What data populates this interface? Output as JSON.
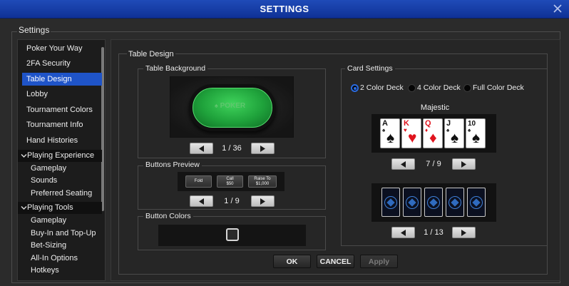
{
  "window": {
    "title": "SETTINGS"
  },
  "main_label": "Settings",
  "sidebar": {
    "items": [
      {
        "label": "Poker Your Way"
      },
      {
        "label": "2FA Security"
      },
      {
        "label": "Table Design",
        "active": true
      },
      {
        "label": "Lobby"
      },
      {
        "label": "Tournament Colors"
      },
      {
        "label": "Tournament Info"
      },
      {
        "label": "Hand Histories"
      }
    ],
    "groups": [
      {
        "label": "Playing Experience",
        "expanded": true,
        "children": [
          "Gameplay",
          "Sounds",
          "Preferred Seating"
        ]
      },
      {
        "label": "Playing Tools",
        "expanded": true,
        "children": [
          "Gameplay",
          "Buy-In and Top-Up",
          "Bet-Sizing",
          "All-In Options",
          "Hotkeys"
        ]
      }
    ]
  },
  "panel": {
    "title": "Table Design",
    "table_background": {
      "label": "Table Background",
      "counter": "1 / 36",
      "logo_text": "POKER"
    },
    "buttons_preview": {
      "label": "Buttons Preview",
      "counter": "1 / 9",
      "buttons": [
        {
          "line1": "Fold",
          "line2": ""
        },
        {
          "line1": "Call",
          "line2": "$50"
        },
        {
          "line1": "Raise To",
          "line2": "$1,000"
        }
      ]
    },
    "button_colors": {
      "label": "Button Colors"
    },
    "card_settings": {
      "label": "Card Settings",
      "deck_options": [
        {
          "label": "2 Color Deck",
          "selected": true
        },
        {
          "label": "4 Color Deck",
          "selected": false
        },
        {
          "label": "Full Color Deck",
          "selected": false
        }
      ],
      "deck_name": "Majestic",
      "face_counter": "7 / 9",
      "back_counter": "1 / 13",
      "cards": [
        {
          "rank": "A",
          "suit": "♠",
          "color": "black"
        },
        {
          "rank": "K",
          "suit": "♥",
          "color": "red"
        },
        {
          "rank": "Q",
          "suit": "♦",
          "color": "red"
        },
        {
          "rank": "J",
          "suit": "♠",
          "color": "black"
        },
        {
          "rank": "10",
          "suit": "♠",
          "color": "black"
        }
      ]
    }
  },
  "footer": {
    "ok": "OK",
    "cancel": "CANCEL",
    "apply": "Apply"
  },
  "colors": {
    "accent": "#1f54c8",
    "titlebar": "#1a43ad",
    "felt": "#22a63f"
  },
  "icons": {
    "close": "close-icon",
    "prev": "arrow-left-icon",
    "next": "arrow-right-icon",
    "expand": "chevron-down-icon"
  }
}
